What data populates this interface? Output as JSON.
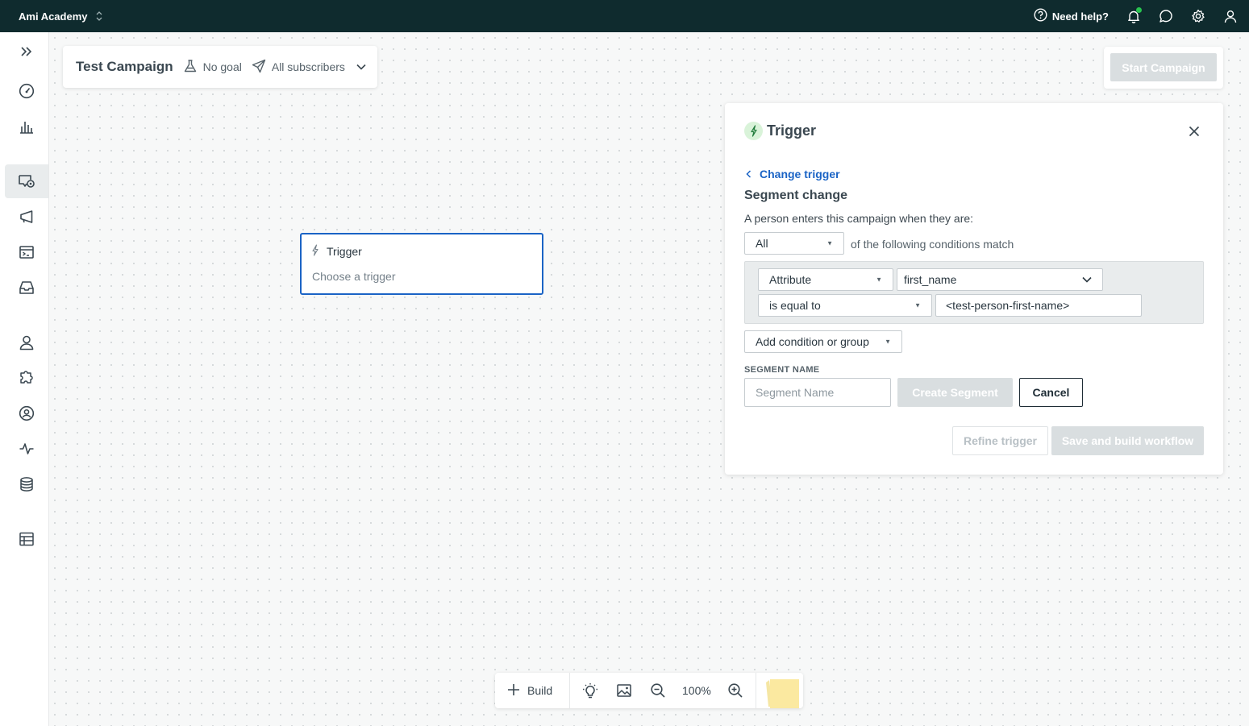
{
  "topbar": {
    "workspace": "Ami Academy",
    "help_label": "Need help?"
  },
  "campaign": {
    "title": "Test Campaign",
    "goal": "No goal",
    "audience": "All subscribers",
    "start_label": "Start Campaign"
  },
  "trigger_node": {
    "title": "Trigger",
    "subtitle": "Choose a trigger"
  },
  "panel": {
    "title": "Trigger",
    "change_trigger": "Change trigger",
    "segment_heading": "Segment change",
    "description": "A person enters this campaign when they are:",
    "match_select": "All",
    "match_suffix": "of the following conditions match",
    "condition": {
      "type": "Attribute",
      "attribute": "first_name",
      "operator": "is equal to",
      "value": "<test-person-first-name>"
    },
    "add_condition": "Add condition or group",
    "segment_name_label": "SEGMENT NAME",
    "segment_name_placeholder": "Segment Name",
    "create_segment": "Create Segment",
    "cancel": "Cancel",
    "refine_trigger": "Refine trigger",
    "save_build": "Save and build workflow"
  },
  "toolbar": {
    "build_label": "Build",
    "zoom": "100%"
  },
  "colors": {
    "topbar": "#0f2b2e",
    "accent": "#1a63c5",
    "disabled": "#d9dee0",
    "notification": "#28c44f"
  }
}
